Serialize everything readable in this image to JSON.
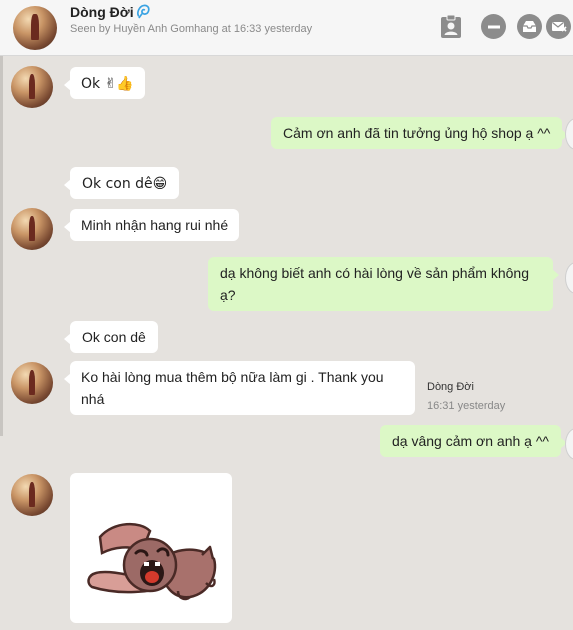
{
  "header": {
    "contact_name": "Dòng Đời",
    "seen_text": "Seen by Huyền Anh Gomhang at 16:33 yesterday",
    "icons": [
      "verified-icon",
      "contact-card-icon",
      "minimize-icon",
      "archive-icon",
      "close-icon"
    ]
  },
  "messages": [
    {
      "dir": "in",
      "text": "Ok ✌👍"
    },
    {
      "dir": "out",
      "text": "Cảm ơn anh đã tin tưởng ủng hộ shop ạ ^^"
    },
    {
      "dir": "in",
      "text": "Ok con dê😁"
    },
    {
      "dir": "in",
      "text": "Minh nhận hang rui nhé"
    },
    {
      "dir": "out",
      "text": "dạ không biết anh có hài lòng về sản phẩm không ạ?"
    },
    {
      "dir": "in",
      "text": "Ok con dê"
    },
    {
      "dir": "in",
      "text": "Ko hài lòng mua thêm bộ nữa làm gi . Thank you nhá"
    },
    {
      "dir": "out",
      "text": "dạ vâng cảm ơn anh ạ ^^"
    },
    {
      "dir": "in",
      "type": "sticker",
      "sticker": "crying-pug-sticker"
    }
  ],
  "message_meta": {
    "sender": "Dòng Đời",
    "time": "16:31 yesterday"
  },
  "colors": {
    "background": "#e5e2de",
    "incoming_bubble": "#ffffff",
    "outgoing_bubble": "#dcf8c6",
    "header": "#f6f6f6",
    "verified": "#3aa3e3"
  }
}
